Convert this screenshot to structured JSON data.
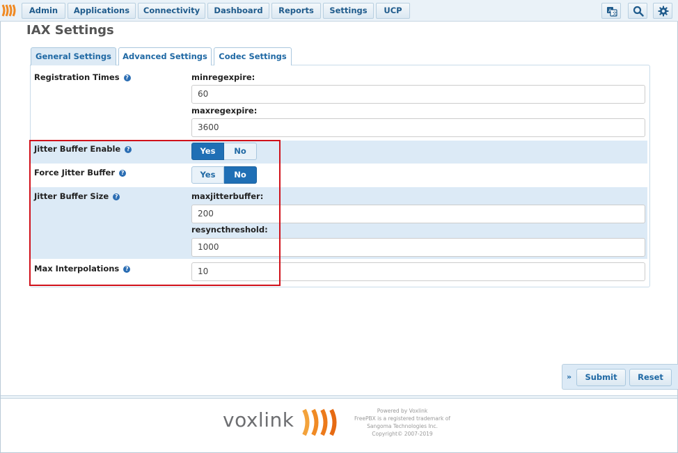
{
  "nav": {
    "items": [
      "Admin",
      "Applications",
      "Connectivity",
      "Dashboard",
      "Reports",
      "Settings",
      "UCP"
    ],
    "icons": [
      "language-icon",
      "search-icon",
      "gear-icon"
    ]
  },
  "page": {
    "title": "IAX Settings"
  },
  "tabs": [
    {
      "label": "General Settings",
      "active": true
    },
    {
      "label": "Advanced Settings",
      "active": false
    },
    {
      "label": "Codec Settings",
      "active": false
    }
  ],
  "form": {
    "registration_times": {
      "label": "Registration Times",
      "minregexpire_label": "minregexpire:",
      "minregexpire_value": "60",
      "maxregexpire_label": "maxregexpire:",
      "maxregexpire_value": "3600"
    },
    "jitter_buffer_enable": {
      "label": "Jitter Buffer Enable",
      "yes": "Yes",
      "no": "No",
      "selected": "Yes"
    },
    "force_jitter_buffer": {
      "label": "Force Jitter Buffer",
      "yes": "Yes",
      "no": "No",
      "selected": "No"
    },
    "jitter_buffer_size": {
      "label": "Jitter Buffer Size",
      "maxjitterbuffer_label": "maxjitterbuffer:",
      "maxjitterbuffer_value": "200",
      "resyncthreshold_label": "resyncthreshold:",
      "resyncthreshold_value": "1000"
    },
    "max_interpolations": {
      "label": "Max Interpolations",
      "value": "10"
    },
    "help_glyph": "?"
  },
  "actions": {
    "submit": "Submit",
    "reset": "Reset",
    "toggle_glyph": "»"
  },
  "footer": {
    "brand": "voxlink",
    "powered": "Powered by Voxlink",
    "trademark_1": "FreePBX is a registered trademark of",
    "trademark_2": "Sangoma Technologies Inc.",
    "copyright": "Copyright© 2007-2019"
  },
  "colors": {
    "accent": "#1f6fb5",
    "highlight_box": "#d0111a",
    "brand_orange": "#f08a24"
  }
}
